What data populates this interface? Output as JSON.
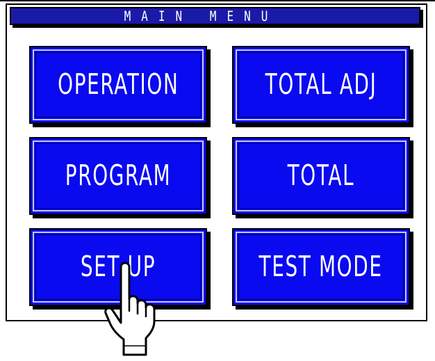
{
  "header": {
    "title": "MAIN MENU"
  },
  "menu": {
    "operation_label": "OPERATION",
    "total_adj_label": "TOTAL ADJ",
    "program_label": "PROGRAM",
    "total_label": "TOTAL",
    "setup_label": "SET UP",
    "test_mode_label": "TEST MODE"
  },
  "pointer": {
    "icon": "pointing-hand-icon",
    "target": "SET UP"
  },
  "colors": {
    "title_bar": "#1a1aa8",
    "button_fill": "#0a0af0",
    "button_text": "#ffffff",
    "background": "#ffffff"
  }
}
